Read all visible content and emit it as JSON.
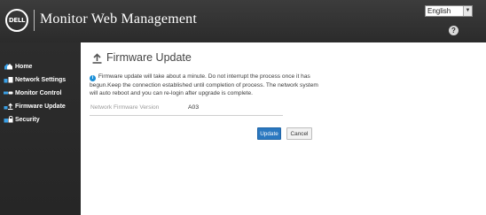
{
  "header": {
    "logo_text": "DELL",
    "title": "Monitor Web Management",
    "language": {
      "selected": "English"
    }
  },
  "sidebar": {
    "items": [
      {
        "label": "Home",
        "icon": "home-icon"
      },
      {
        "label": "Network Settings",
        "icon": "network-icon"
      },
      {
        "label": "Monitor Control",
        "icon": "monitor-control-icon"
      },
      {
        "label": "Firmware Update",
        "icon": "firmware-update-icon"
      },
      {
        "label": "Security",
        "icon": "security-icon"
      }
    ]
  },
  "main": {
    "title": "Firmware Update",
    "notice": "Firmware update will take about a minute. Do not interrupt the process once it has begun.Keep the connection established until completion of process. The network system will auto reboot and you can re-login after upgrade is complete.",
    "field": {
      "label": "Network Firmware Version",
      "value": "A03"
    },
    "buttons": {
      "update": "Update",
      "cancel": "Cancel"
    }
  },
  "colors": {
    "header_bg": "#333333",
    "sidebar_bg": "#2a2a2a",
    "accent": "#2a78c0",
    "info": "#1a8fd8"
  }
}
